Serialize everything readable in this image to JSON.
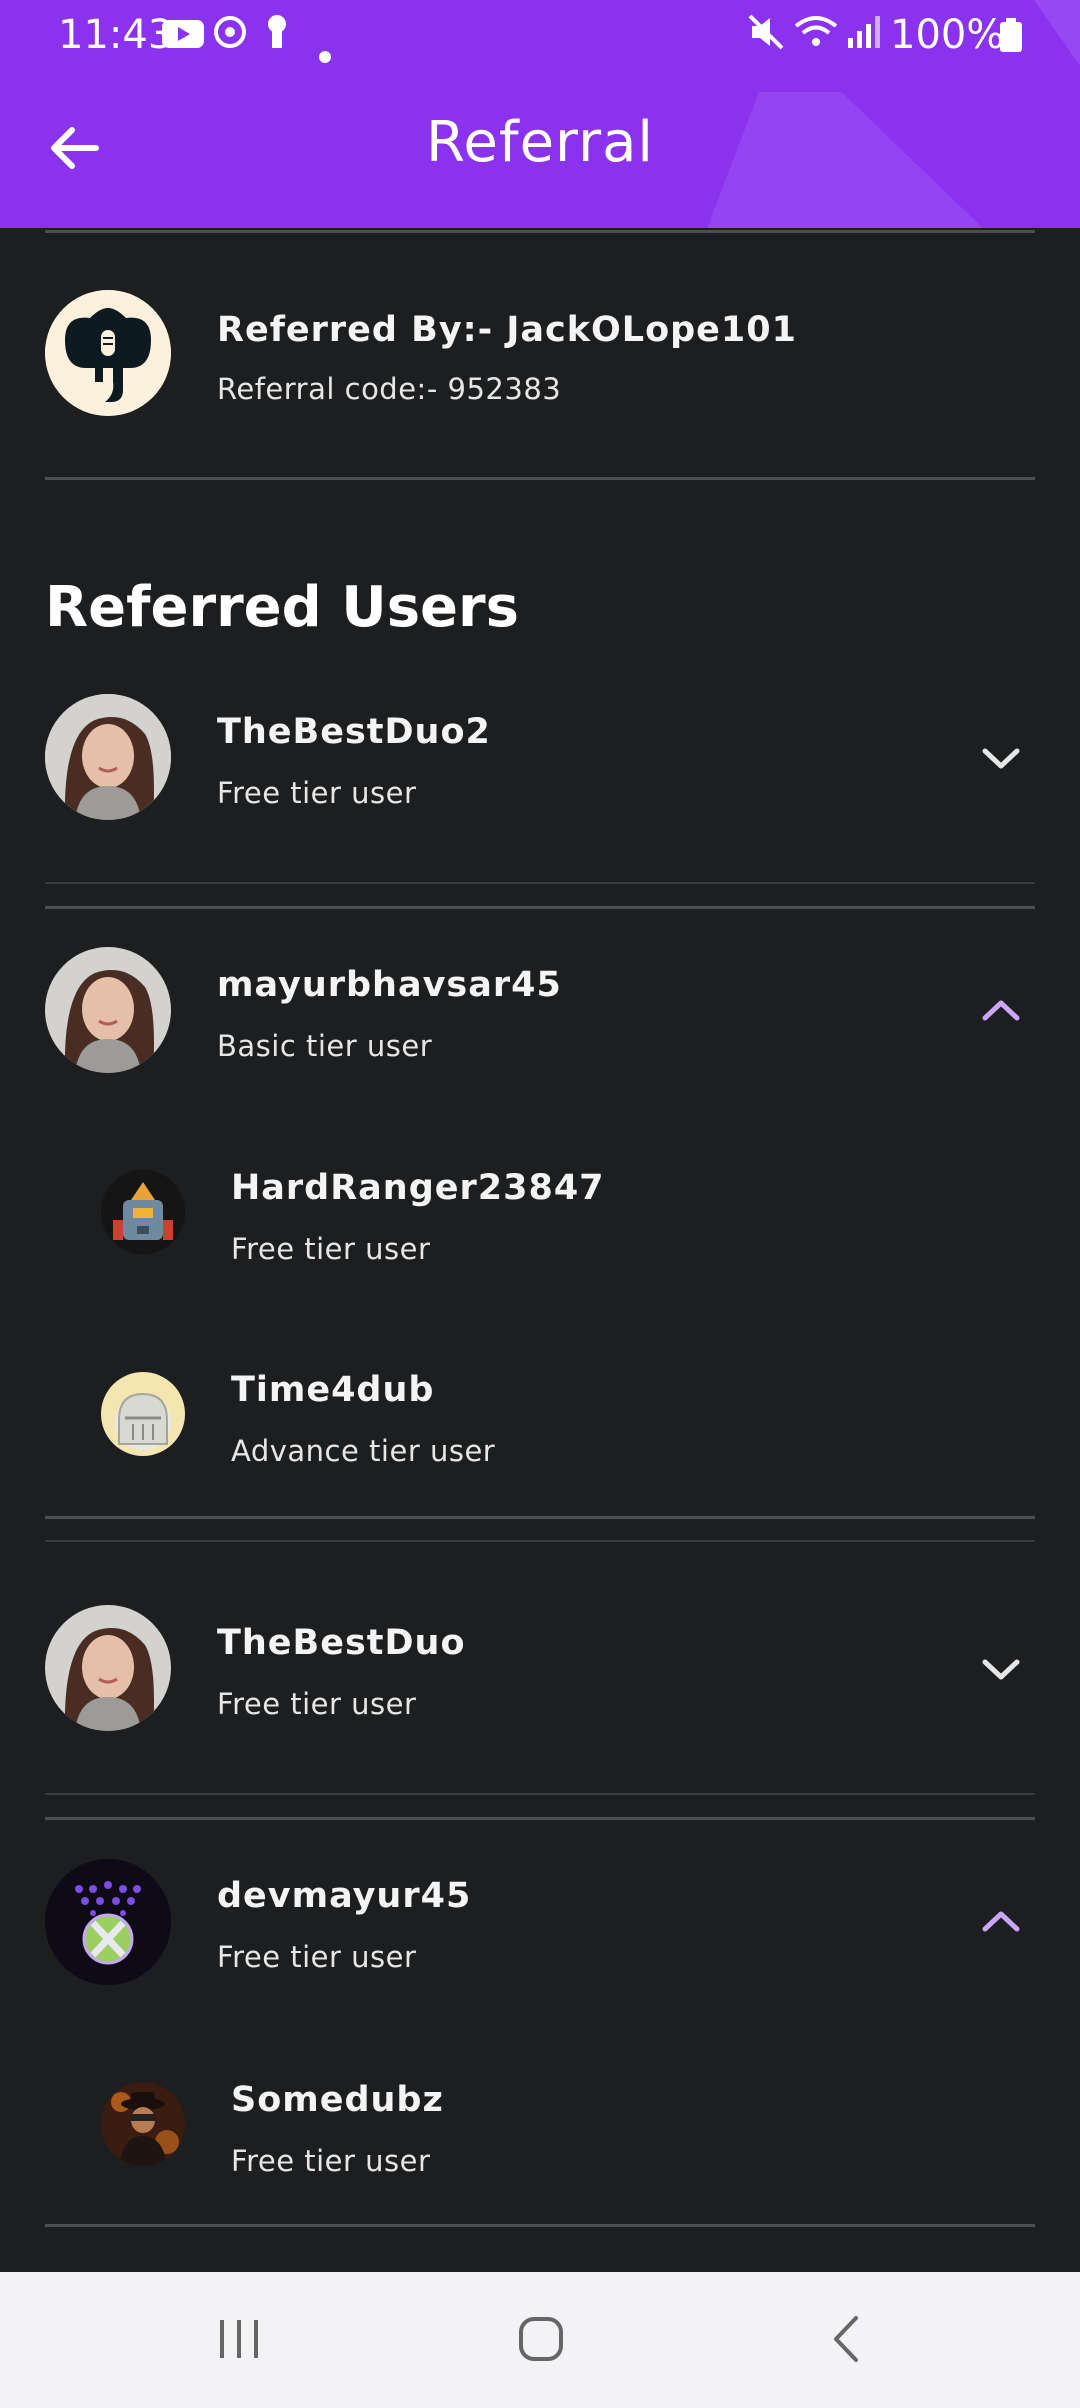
{
  "status": {
    "time": "11:43",
    "battery": "100%"
  },
  "appbar": {
    "title": "Referral"
  },
  "referrer": {
    "label": "Referred By:- JackOLope101",
    "code": "Referral code:- 952383"
  },
  "section_title": "Referred Users",
  "users": [
    {
      "name": "TheBestDuo2",
      "tier": "Free tier user",
      "expanded": false
    },
    {
      "name": "mayurbhavsar45",
      "tier": "Basic tier user",
      "expanded": true,
      "children": [
        {
          "name": "HardRanger23847",
          "tier": "Free tier user"
        },
        {
          "name": "Time4dub",
          "tier": "Advance tier user"
        }
      ]
    },
    {
      "name": "TheBestDuo",
      "tier": "Free tier user",
      "expanded": false
    },
    {
      "name": "devmayur45",
      "tier": "Free tier user",
      "expanded": true,
      "children": [
        {
          "name": "Somedubz",
          "tier": "Free tier user"
        }
      ]
    }
  ],
  "colors": {
    "accent": "#8a32ee",
    "chevron_open": "#c9a6f7",
    "background": "#1c1e1f"
  }
}
